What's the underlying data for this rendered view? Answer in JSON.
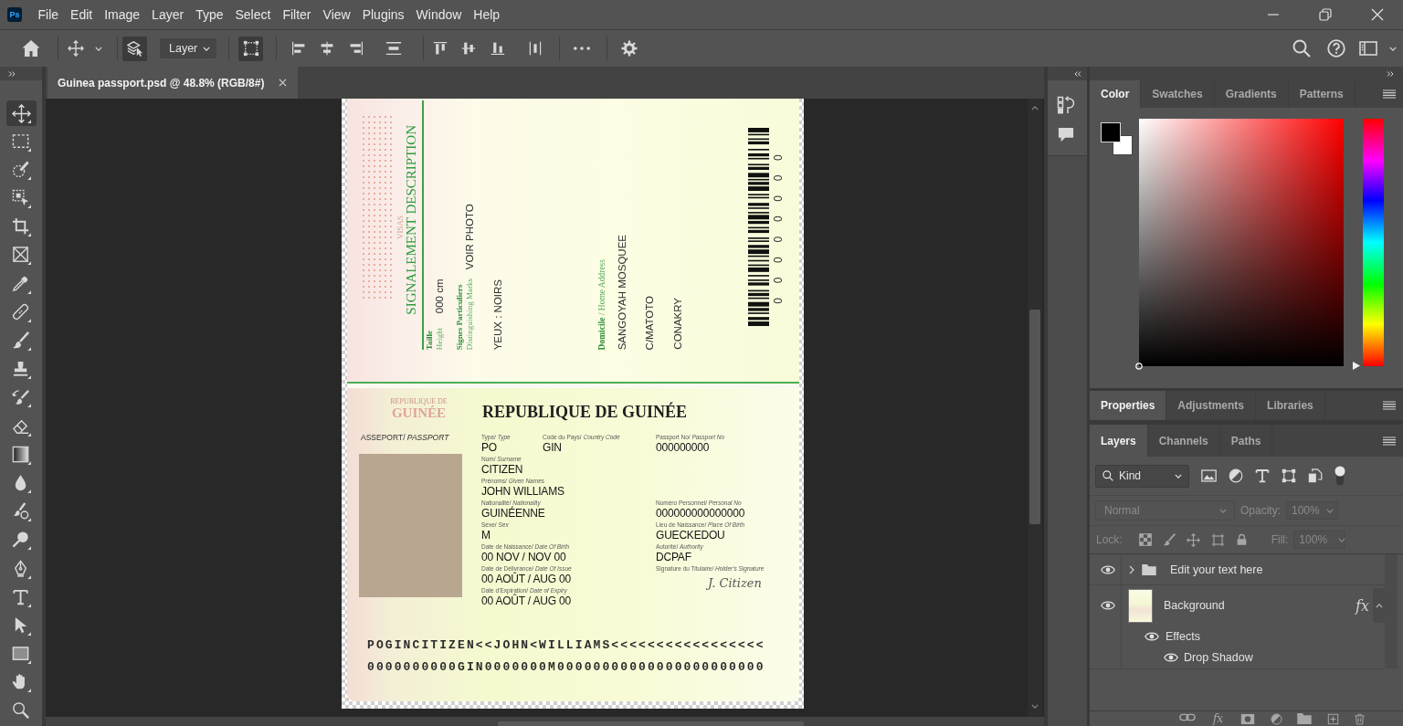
{
  "app_logo": "Ps",
  "menu": [
    "File",
    "Edit",
    "Image",
    "Layer",
    "Type",
    "Select",
    "Filter",
    "View",
    "Plugins",
    "Window",
    "Help"
  ],
  "options_bar": {
    "target": "Layer"
  },
  "document": {
    "tab_title": "Guinea passport.psd @ 48.8% (RGB/8#)"
  },
  "tools": [
    {
      "kind": "move",
      "selected": true
    },
    {
      "kind": "marquee",
      "selected": false
    },
    {
      "kind": "quickselect",
      "selected": false
    },
    {
      "kind": "objectselect",
      "selected": false
    },
    {
      "kind": "crop",
      "selected": false
    },
    {
      "kind": "frame",
      "selected": false
    },
    {
      "kind": "eyedropper",
      "selected": false
    },
    {
      "kind": "healing",
      "selected": false
    },
    {
      "kind": "brush",
      "selected": false
    },
    {
      "kind": "stamp",
      "selected": false
    },
    {
      "kind": "historybrush",
      "selected": false
    },
    {
      "kind": "eraser",
      "selected": false
    },
    {
      "kind": "gradient",
      "selected": false
    },
    {
      "kind": "blur",
      "selected": false
    },
    {
      "kind": "mixer",
      "selected": false
    },
    {
      "kind": "dodge",
      "selected": false
    },
    {
      "kind": "pen",
      "selected": false
    },
    {
      "kind": "type",
      "selected": false
    },
    {
      "kind": "pathselect",
      "selected": false
    },
    {
      "kind": "rectangle",
      "selected": false
    },
    {
      "kind": "hand",
      "selected": false
    },
    {
      "kind": "zoom",
      "selected": false
    }
  ],
  "passport": {
    "description_page": {
      "visas": "VISAS",
      "heading": "SIGNALEMENT DESCRIPTION",
      "height": {
        "label_fr": "Taille",
        "label_en": "Height",
        "value": "000 cm"
      },
      "marks": {
        "label_fr": "Signes Particuliers",
        "label_en": "Distinguishing Marks",
        "value": "VOIR PHOTO"
      },
      "eyes": "YEUX : NOIRS",
      "address_label": "**Domicile** / Home Address",
      "address_lines": [
        "SANGOYAH MOSQUEE",
        "C/MATOTO",
        "CONAKRY"
      ],
      "barcode_number": "0 0 0 0 0 0 0 0"
    },
    "data_page": {
      "emblem": [
        "REPUBLIQUE DE",
        "GUINÉE"
      ],
      "title": "REPUBLIQUE DE GUINÉE",
      "document_type": "ASSEPORT/ *PASSPORT*",
      "top_fields": [
        {
          "label": "Type/ *Type*",
          "value": "PO"
        },
        {
          "label": "Code du Pays/ *Country Code*",
          "value": "GIN"
        },
        {
          "label": "Passport No/ *Passport No*",
          "value": "000000000"
        }
      ],
      "left_fields": [
        {
          "label": "Nom/ *Surname*",
          "value": "CITIZEN"
        },
        {
          "label": "Prénoms/ *Given Names*",
          "value": "JOHN WILLIAMS"
        },
        {
          "label": "Nationalité/ *Nationality*",
          "value": "GUINÉENNE"
        },
        {
          "label": "Sexe/ *Sex*",
          "value": "M"
        },
        {
          "label": "Date de Naissance/ *Date Of Birth*",
          "value": "00 NOV / NOV 00"
        },
        {
          "label": "Date de Délivrance/ *Date Of Issue*",
          "value": "00 AOÛT / AUG 00"
        },
        {
          "label": "Date d'Expiration/ *Date of Expiry*",
          "value": "00 AOÛT / AUG 00"
        }
      ],
      "right_fields": [
        {
          "kind": "text",
          "label": "Numéro Personnel/ *Personal No*",
          "value": "000000000000000"
        },
        {
          "kind": "text",
          "label": "Lieu de Naissance/ *Place Of Birth*",
          "value": "GUECKEDOU"
        },
        {
          "kind": "text",
          "label": "Autorité/ *Authority*",
          "value": "DCPAF"
        },
        {
          "kind": "signature",
          "label": "Signature du Titulaire/ *Holder's Signature*",
          "value": "J. Citizen"
        }
      ],
      "mrz": [
        "POGINCITIZEN<<JOHN<WILLIAMS<<<<<<<<<<<<<<<<<",
        "0000000000GIN0000000M00000000000000000000000"
      ]
    }
  },
  "dock": {
    "color_panel": {
      "tabs": [
        {
          "label": "Color",
          "selected": true
        },
        {
          "label": "Swatches",
          "selected": false
        },
        {
          "label": "Gradients",
          "selected": false
        },
        {
          "label": "Patterns",
          "selected": false
        }
      ],
      "foreground": {
        "color": "#000000"
      },
      "background": {
        "color": "#ffffff"
      }
    },
    "properties_panel": {
      "tabs": [
        {
          "label": "Properties",
          "selected": true
        },
        {
          "label": "Adjustments",
          "selected": false
        },
        {
          "label": "Libraries",
          "selected": false
        }
      ]
    },
    "layers_panel": {
      "tabs": [
        {
          "label": "Layers",
          "selected": true
        },
        {
          "label": "Channels",
          "selected": false
        },
        {
          "label": "Paths",
          "selected": false
        }
      ],
      "filter": {
        "value": "Kind"
      },
      "blend_mode": {
        "value": "Normal",
        "disabled": true
      },
      "opacity": {
        "label": "Opacity:",
        "value": "100%",
        "disabled": true
      },
      "lock": {
        "label": "Lock:"
      },
      "fill": {
        "label": "Fill:",
        "value": "100%",
        "disabled": true
      },
      "layers": [
        {
          "kind": "group",
          "name": "Edit your text here",
          "visible": true,
          "expanded": false
        },
        {
          "kind": "image",
          "name": "Background",
          "visible": true,
          "fx": "fx",
          "expanded": true,
          "effects": {
            "name": "Effects",
            "visible": true,
            "children": [
              {
                "name": "Drop Shadow",
                "visible": true
              }
            ]
          }
        }
      ],
      "footer_buttons": [
        {
          "kind": "link"
        },
        {
          "kind": "fx",
          "label": "fx"
        },
        {
          "kind": "mask"
        },
        {
          "kind": "adjustment"
        },
        {
          "kind": "group"
        },
        {
          "kind": "new"
        },
        {
          "kind": "delete"
        }
      ]
    }
  }
}
